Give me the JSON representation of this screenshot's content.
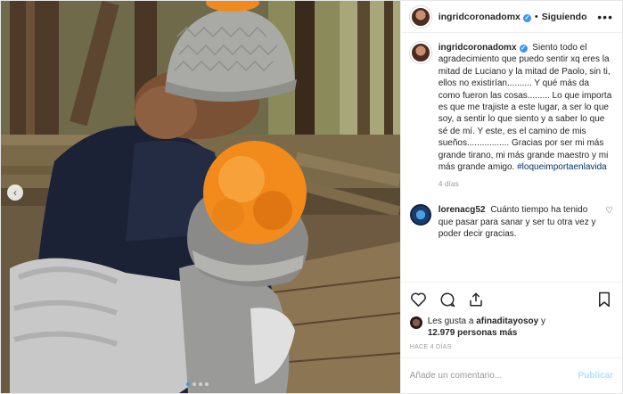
{
  "post": {
    "username": "ingridcoronadomx",
    "separator": "•",
    "follow_status": "Siguiendo",
    "more_label": "•••",
    "verified_mark": "✓"
  },
  "caption": {
    "username": "ingridcoronadomx",
    "text": "Siento todo el agradecimiento que puedo sentir xq eres la mitad de Luciano y la mitad de Paolo, sin ti, ellos no existirían.......... Y qué más da como fueron las cosas......... Lo que importa es que me trajiste a este lugar, a ser lo que soy, a sentir lo que siento y a saber lo que sé de mí. Y este, es el camino de mis sueños................. Gracias por ser mi más grande tirano, mi más grande maestro y mi más grande amigo.",
    "hashtag": "#loqueimportaenlavida",
    "time_ago": "4 días"
  },
  "comment": {
    "username": "lorenacg52",
    "text": "Cuánto tiempo ha tenido que pasar para sanar y ser tu otra vez y poder decir gracias."
  },
  "actions": {
    "like_icon": "heart-icon",
    "comment_icon": "comment-icon",
    "share_icon": "share-icon",
    "save_icon": "bookmark-icon",
    "comment_like_glyph": "♡"
  },
  "likes": {
    "prefix": "Les gusta a ",
    "liker": "afinaditayosoy",
    "middle": " y ",
    "count": "12.979",
    "suffix": " personas más"
  },
  "date_label": "HACE 4 DÍAS",
  "add_comment": {
    "placeholder": "Añade un comentario...",
    "publish_label": "Publicar"
  },
  "carousel": {
    "prev_glyph": "‹",
    "total_slides": 4,
    "active_slide": 1
  },
  "colors": {
    "accent": "#3897f0",
    "hashtag": "#003569",
    "publish_disabled": "#b2dffc",
    "pompom": "#f28a1c"
  }
}
